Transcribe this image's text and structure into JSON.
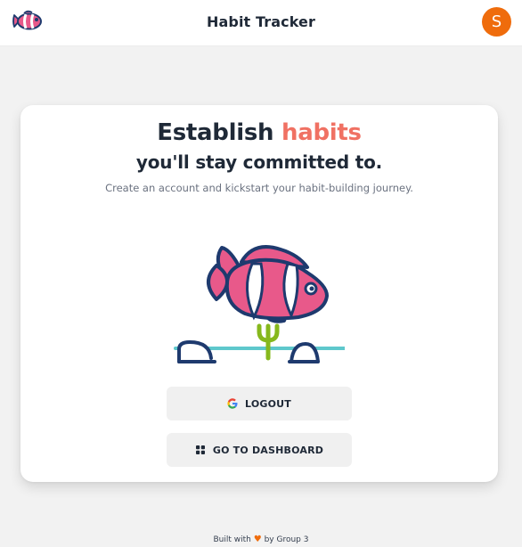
{
  "navbar": {
    "logo": "clownfish-logo-icon",
    "title": "Habit Tracker",
    "avatar_initial": "S"
  },
  "hero": {
    "headline_prefix": "Establish",
    "headline_accent": "habits",
    "headline_line2": "you'll stay committed to.",
    "subtext": "Create an account and kickstart your habit-building journey.",
    "illustration": "clownfish-illustration"
  },
  "actions": {
    "logout_label": "LOGOUT",
    "logout_icon": "google-icon",
    "dashboard_label": "GO TO DASHBOARD",
    "dashboard_icon": "dashboard-grid-icon"
  },
  "footer": {
    "prefix": "Built with",
    "icon": "heart-icon",
    "suffix": "by Group 3"
  },
  "colors": {
    "accent": "#f07163",
    "avatar": "#ef6c0c",
    "fish_pink": "#e8598a",
    "fish_outline": "#1e3a6e",
    "plant_green": "#86b81c",
    "water_line": "#5ec8cc"
  }
}
